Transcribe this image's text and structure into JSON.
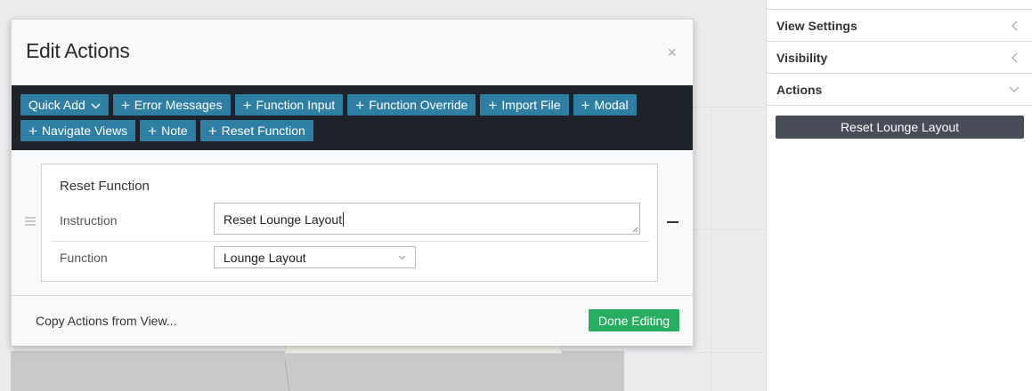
{
  "modal": {
    "title": "Edit Actions",
    "close": "×",
    "toolbar": {
      "quick_add": "Quick Add",
      "buttons": [
        "Error Messages",
        "Function Input",
        "Function Override",
        "Import File",
        "Modal",
        "Navigate Views",
        "Note",
        "Reset Function"
      ]
    },
    "card": {
      "title": "Reset Function",
      "instruction_label": "Instruction",
      "instruction_value": "Reset Lounge Layout",
      "function_label": "Function",
      "function_value": "Lounge Layout"
    },
    "footer": {
      "copy_link": "Copy Actions from View...",
      "done": "Done Editing"
    }
  },
  "sidebar": {
    "sections": [
      "View Settings",
      "Visibility",
      "Actions"
    ],
    "action_button": "Reset Lounge Layout"
  },
  "colors": {
    "toolbar_bg": "#1e232b",
    "toolbar_button": "#2f7fa5",
    "done_button": "#27ae60",
    "sidebar_button": "#474c58"
  }
}
